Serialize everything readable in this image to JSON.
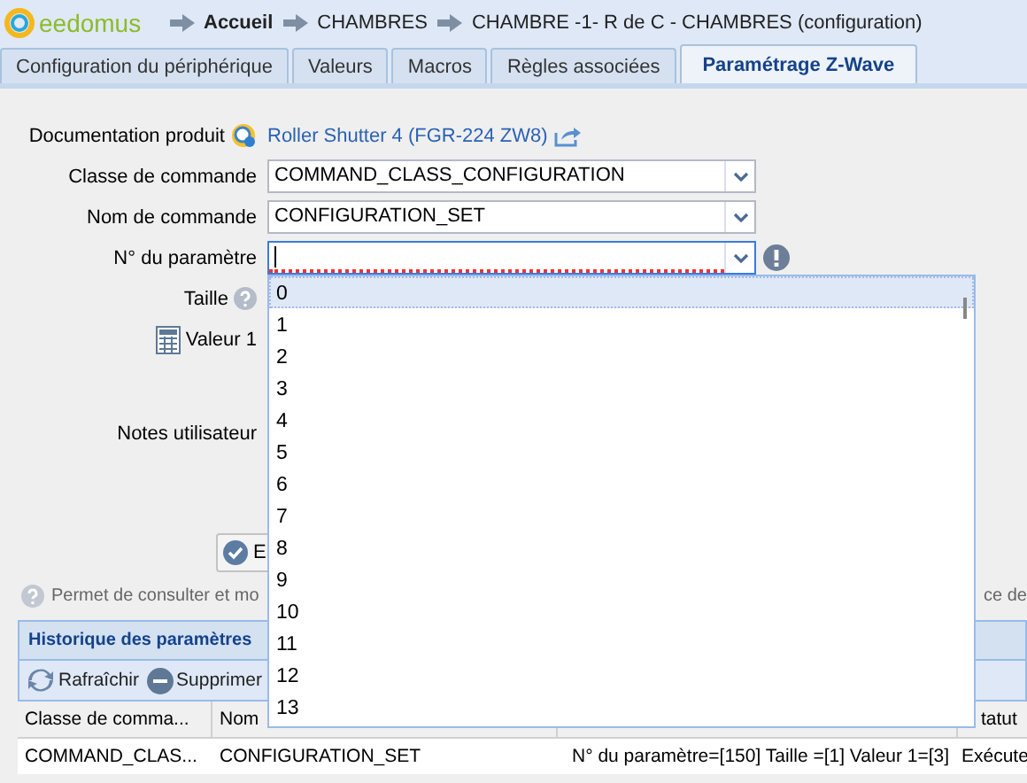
{
  "header": {
    "logo": "eedomus",
    "breadcrumb": [
      {
        "label": "Accueil",
        "current": true
      },
      {
        "label": "CHAMBRES",
        "current": false
      },
      {
        "label": "CHAMBRE -1- R de C - CHAMBRES (configuration)",
        "current": false
      }
    ]
  },
  "tabs": [
    {
      "label": "Configuration du périphérique",
      "selected": false
    },
    {
      "label": "Valeurs",
      "selected": false
    },
    {
      "label": "Macros",
      "selected": false
    },
    {
      "label": "Règles associées",
      "selected": false
    },
    {
      "label": "Paramétrage Z-Wave",
      "selected": true
    }
  ],
  "form": {
    "doc_label": "Documentation produit",
    "doc_link": "Roller Shutter 4 (FGR-224 ZW8)",
    "fields": [
      {
        "label": "Classe de commande",
        "value": "COMMAND_CLASS_CONFIGURATION",
        "invalid": false
      },
      {
        "label": "Nom de commande",
        "value": "CONFIGURATION_SET",
        "invalid": false
      },
      {
        "label": "N° du paramètre",
        "invalid": true
      }
    ],
    "size_label": "Taille",
    "value_label": "Valeur 1",
    "notes_label": "Notes utilisateur",
    "button": "E",
    "help_left": "Permet de consulter et mo",
    "help_right": "ce de"
  },
  "dropdown": {
    "items": [
      {
        "label": "0",
        "selected": true
      },
      {
        "label": "1",
        "selected": false
      },
      {
        "label": "2",
        "selected": false
      },
      {
        "label": "3",
        "selected": false
      },
      {
        "label": "4",
        "selected": false
      },
      {
        "label": "5",
        "selected": false
      },
      {
        "label": "6",
        "selected": false
      },
      {
        "label": "7",
        "selected": false
      },
      {
        "label": "8",
        "selected": false
      },
      {
        "label": "9",
        "selected": false
      },
      {
        "label": "10",
        "selected": false
      },
      {
        "label": "11",
        "selected": false
      },
      {
        "label": "12",
        "selected": false
      },
      {
        "label": "13",
        "selected": false
      }
    ]
  },
  "history": {
    "title": "Historique des paramètres",
    "toolbar": [
      "Rafraîchir",
      "Supprimer"
    ],
    "columns": [
      "Classe de comma...",
      "Nom",
      "",
      "tatut"
    ],
    "rows": [
      [
        "COMMAND_CLAS...",
        "CONFIGURATION_SET",
        "N° du paramètre=[150] Taille =[1] Valeur 1=[3]",
        "Exécute"
      ]
    ]
  }
}
